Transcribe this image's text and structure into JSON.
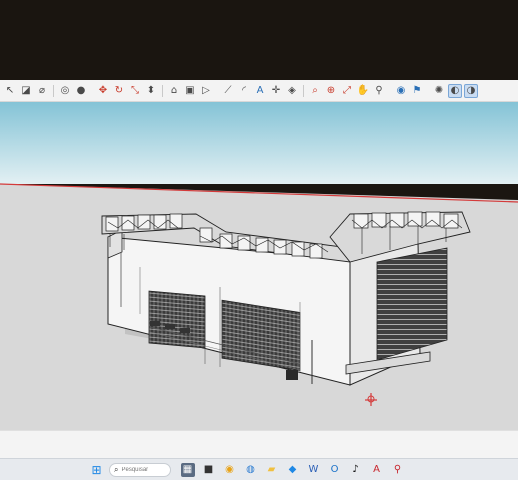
{
  "window": {
    "app": "SketchUp",
    "toolbar_icons": [
      "select-icon",
      "eraser-icon",
      "tape-measure-icon",
      "orbit-icon",
      "user-icon",
      "move-icon",
      "rotate-icon",
      "scale-icon",
      "push-pull-icon",
      "paint-bucket-icon",
      "offset-icon",
      "follow-me-icon",
      "dimension-icon",
      "protractor-icon",
      "text-icon",
      "axes-icon",
      "section-plane-icon",
      "zoom-icon",
      "zoom-window-icon",
      "zoom-extents-icon",
      "pan-icon",
      "walk-icon",
      "look-around-icon",
      "position-camera-icon",
      "shadows-icon",
      "fog-icon",
      "x-ray-icon"
    ]
  },
  "viewport": {
    "sky_top": "#84c3d6",
    "sky_bottom": "#e3f0f3",
    "ground": "#d8d8d8",
    "red_axis": "#d43a3a",
    "model": "wall-hung-hvac-unit-3d-model",
    "origin_marker": "axes-origin-icon"
  },
  "taskbar": {
    "search_placeholder": "Pesquisar",
    "apps": [
      "windows-start-icon",
      "search-icon",
      "widgets-icon",
      "file-explorer-icon",
      "chrome-icon",
      "edge-icon",
      "folder-icon",
      "store-icon",
      "word-icon",
      "outlook-icon",
      "tiktok-icon",
      "autocad-icon",
      "sketchup-icon"
    ]
  }
}
